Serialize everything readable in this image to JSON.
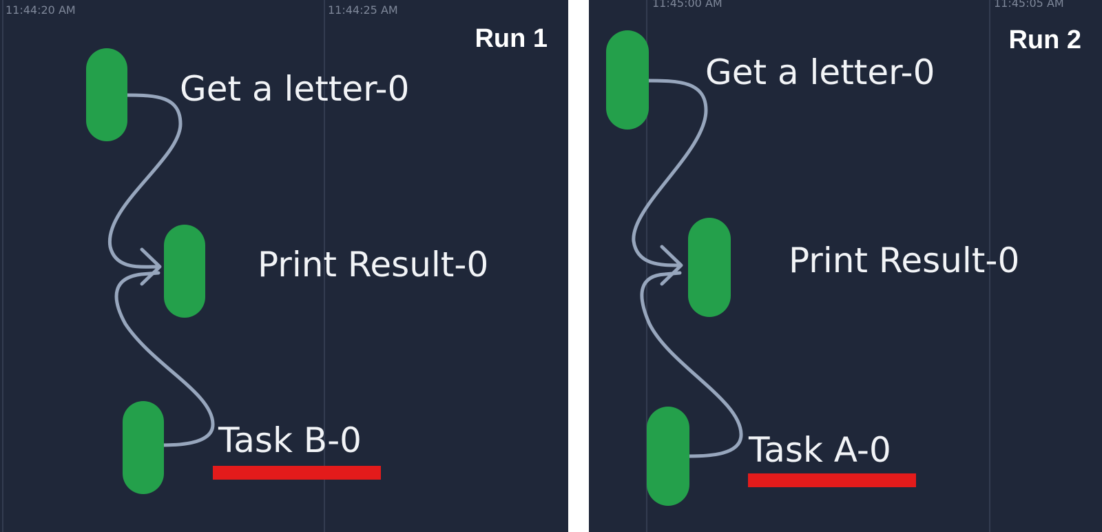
{
  "colors": {
    "panel_background": "#1f2739",
    "node": "#24a04b",
    "edge": "#97a6bd",
    "highlight_underline": "#e31b1b"
  },
  "runs": [
    {
      "label": "Run 1",
      "timestamps": [
        "11:44:20 AM",
        "11:44:25 AM"
      ],
      "tasks": {
        "top": "Get a letter-0",
        "middle": "Print Result-0",
        "bottom": "Task B-0"
      },
      "highlighted_task": "bottom"
    },
    {
      "label": "Run 2",
      "timestamps": [
        "11:45:00 AM",
        "11:45:05 AM"
      ],
      "tasks": {
        "top": "Get a letter-0",
        "middle": "Print Result-0",
        "bottom": "Task A-0"
      },
      "highlighted_task": "bottom"
    }
  ]
}
